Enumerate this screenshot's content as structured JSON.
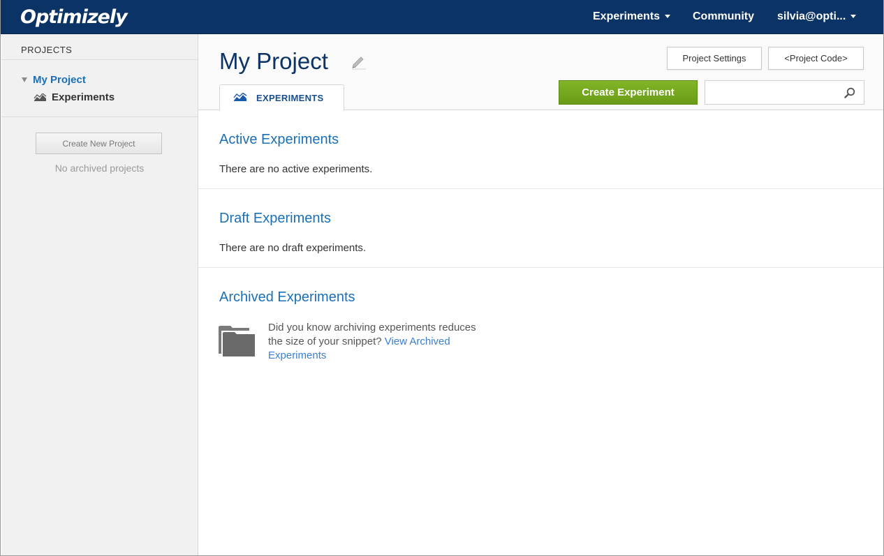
{
  "app": {
    "logo": "Optimizely"
  },
  "topnav": {
    "experiments": "Experiments",
    "community": "Community",
    "user": "silvia@opti..."
  },
  "sidebar": {
    "header": "PROJECTS",
    "project": "My Project",
    "experiments": "Experiments",
    "create_button": "Create New Project",
    "no_archived": "No archived projects"
  },
  "main": {
    "title": "My Project",
    "project_settings": "Project Settings",
    "project_code": "<Project Code>",
    "tab": "EXPERIMENTS",
    "create_experiment": "Create Experiment",
    "search_value": "",
    "sections": {
      "active": {
        "title": "Active Experiments",
        "text": "There are no active experiments."
      },
      "draft": {
        "title": "Draft Experiments",
        "text": "There are no draft experiments."
      },
      "archived": {
        "title": "Archived Experiments",
        "text": "Did you know archiving experiments reduces the size of your snippet?",
        "link": "View Archived Experiments"
      }
    }
  },
  "colors": {
    "nav_bg": "#0c3366",
    "accent_blue": "#1a6fb7",
    "create_green": "#76a81f"
  },
  "icons": [
    "chevron-down-icon",
    "caret-down-icon",
    "chart-icon",
    "pencil-icon",
    "search-icon",
    "folder-icon"
  ]
}
